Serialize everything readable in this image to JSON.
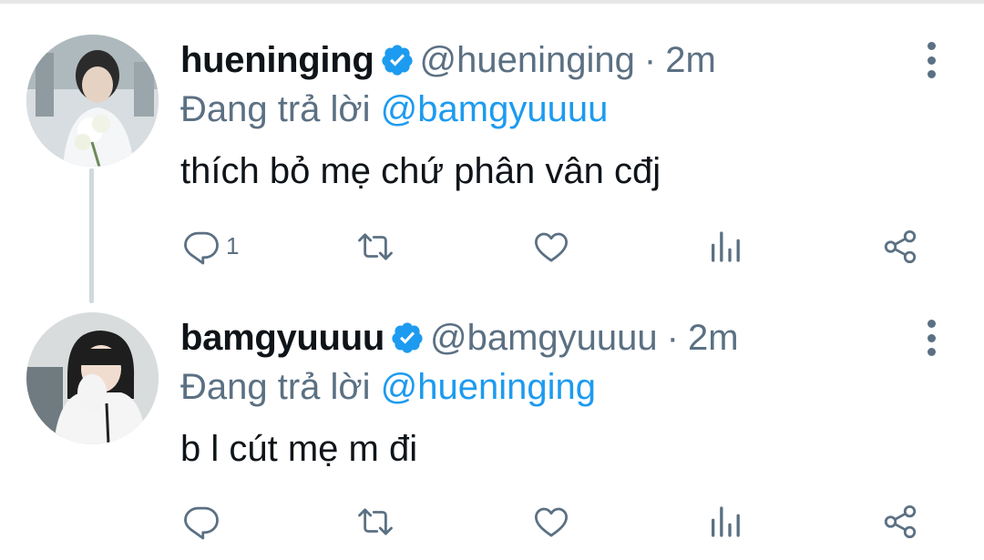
{
  "tweets": [
    {
      "display_name": "hueninging",
      "handle": "@hueninging",
      "separator": "·",
      "time": "2m",
      "replying_prefix": "Đang trả lời",
      "replying_to": "@bamgyuuuu",
      "text": "thích bỏ mẹ chứ phân vân cđj",
      "reply_count": "1",
      "icons": [
        "reply-icon",
        "retweet-icon",
        "like-icon",
        "analytics-icon",
        "share-icon",
        "more-icon",
        "verified-badge-icon"
      ]
    },
    {
      "display_name": "bamgyuuuu",
      "handle": "@bamgyuuuu",
      "separator": "·",
      "time": "2m",
      "replying_prefix": "Đang trả lời",
      "replying_to": "@hueninging",
      "text": "b l cút mẹ m đi",
      "reply_count": "",
      "icons": [
        "reply-icon",
        "retweet-icon",
        "like-icon",
        "analytics-icon",
        "share-icon",
        "more-icon",
        "verified-badge-icon"
      ]
    }
  ],
  "colors": {
    "accent": "#1d9bf0",
    "secondary_text": "#5b7083",
    "primary_text": "#0f1419",
    "icon": "#5b7083",
    "thread_line": "#cfd9de"
  }
}
